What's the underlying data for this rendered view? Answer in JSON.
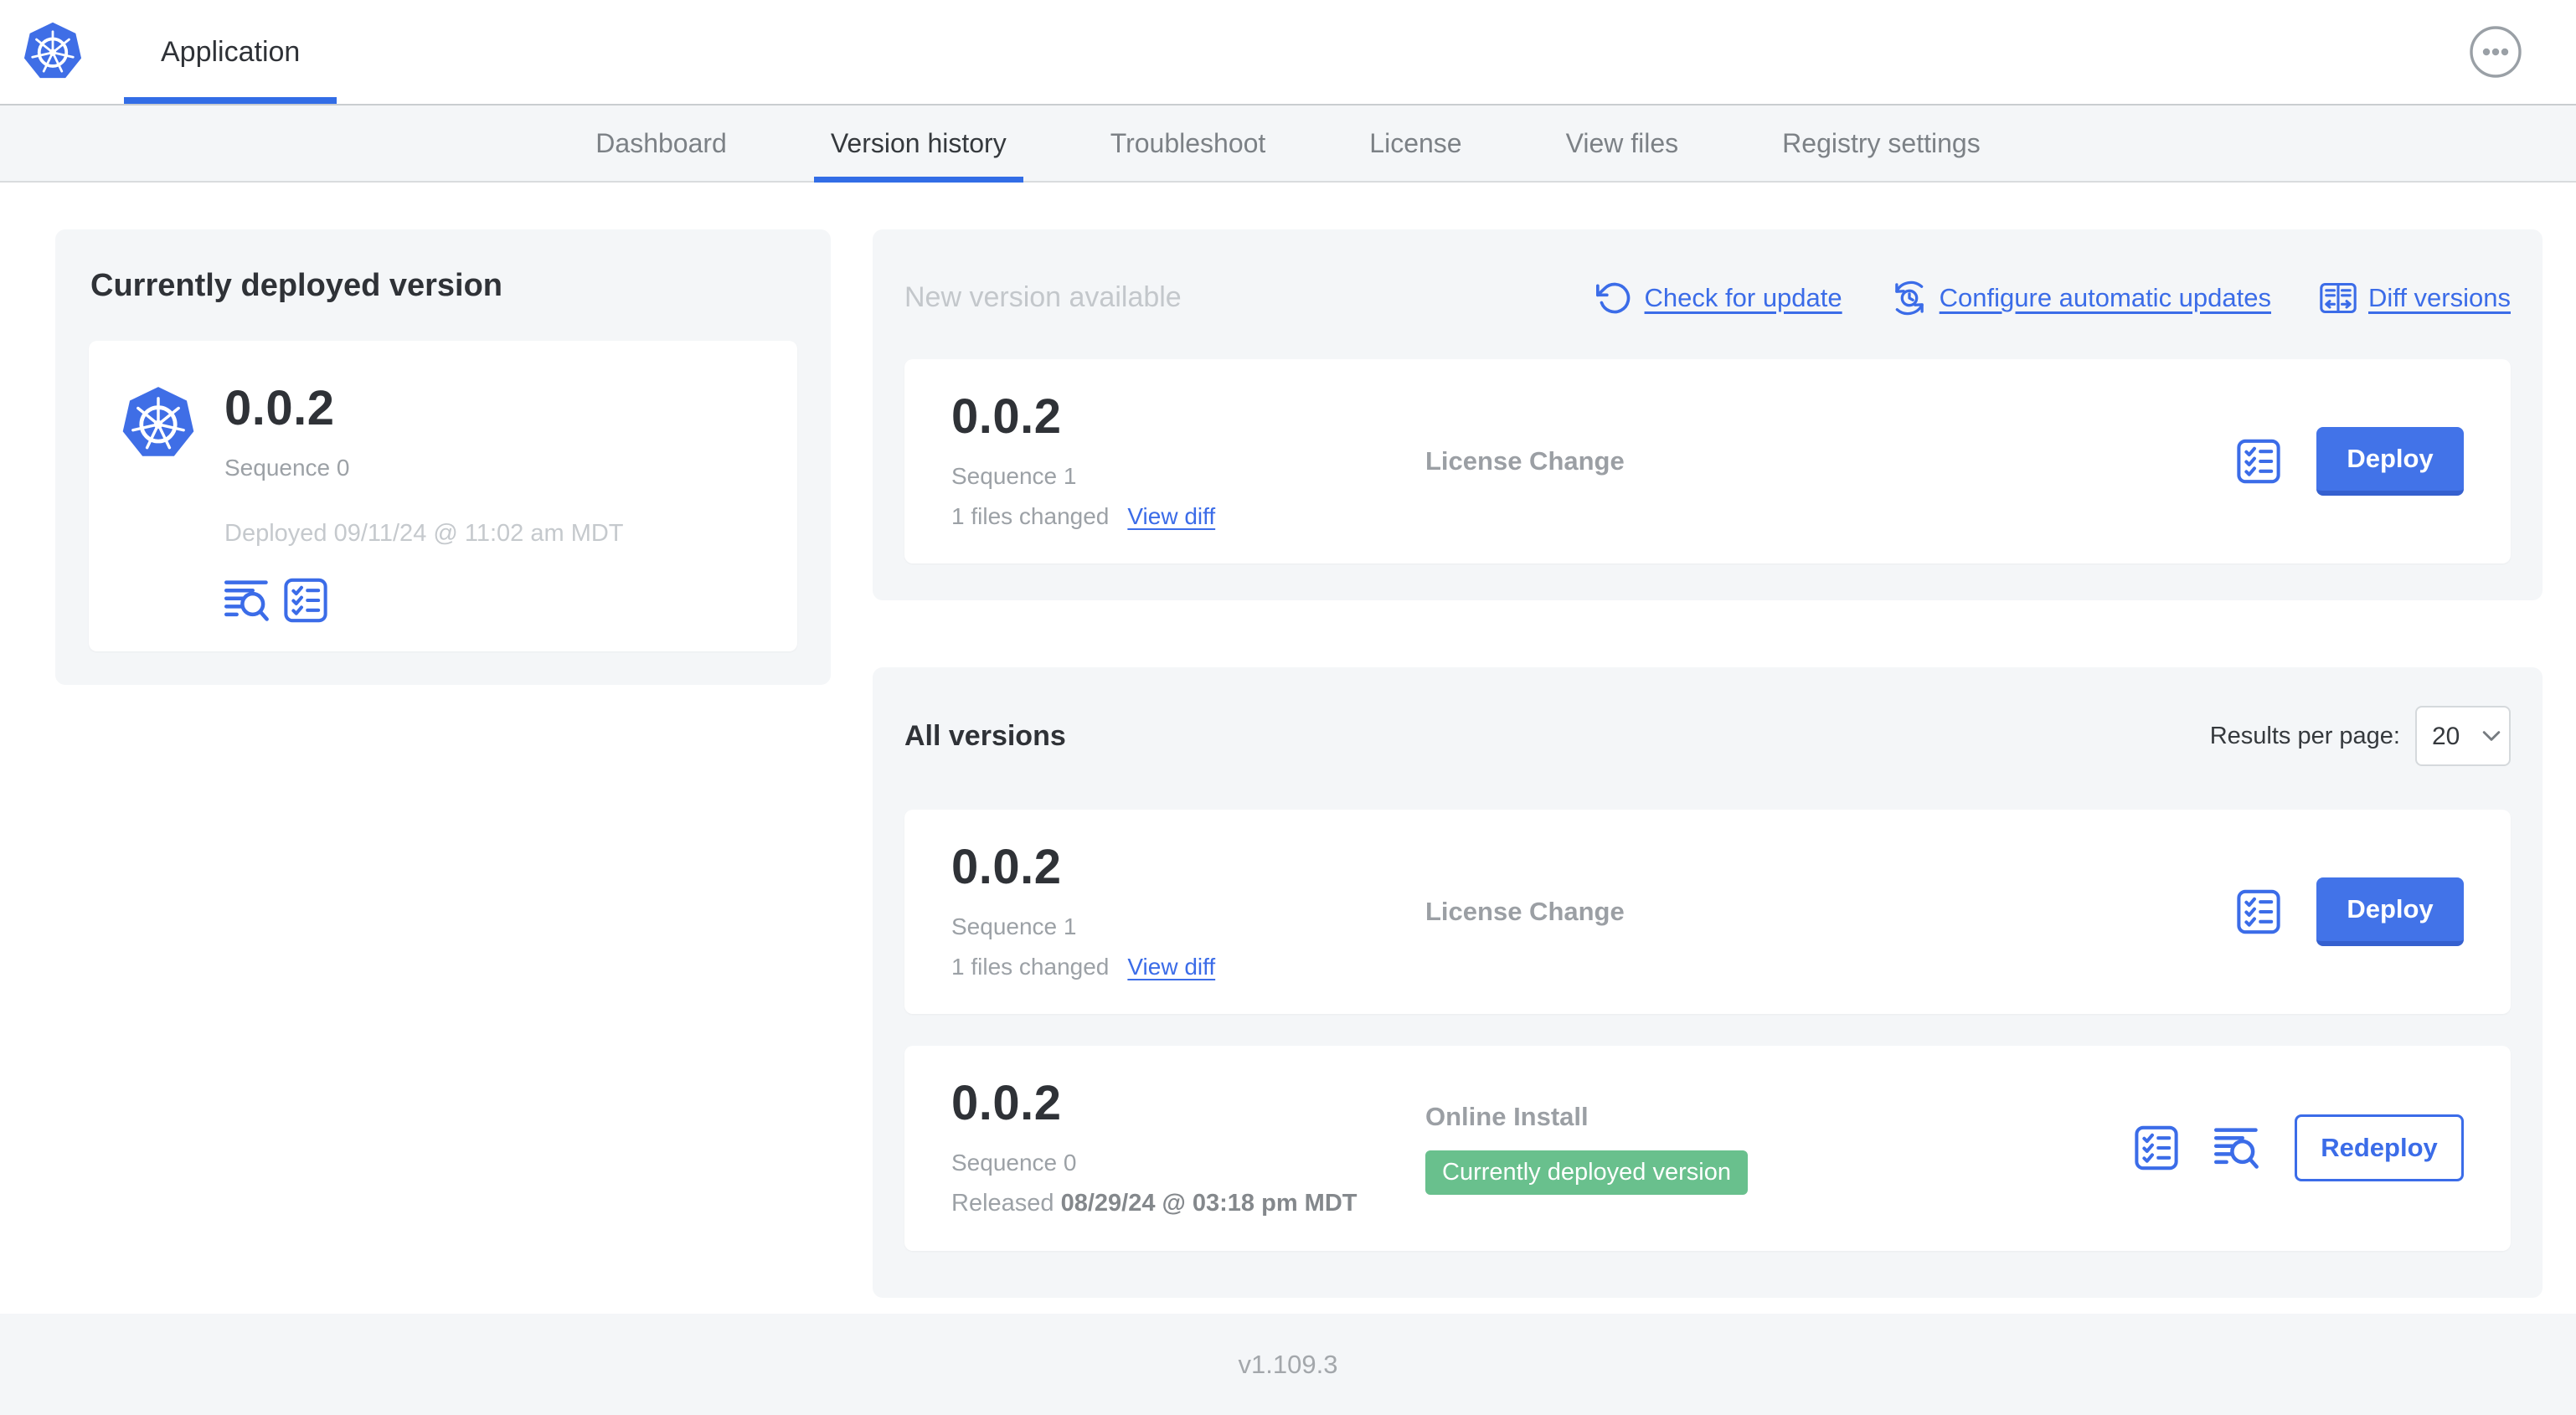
{
  "header": {
    "app_label": "Application"
  },
  "nav": {
    "tabs": [
      {
        "label": "Dashboard",
        "active": false
      },
      {
        "label": "Version history",
        "active": true
      },
      {
        "label": "Troubleshoot",
        "active": false
      },
      {
        "label": "License",
        "active": false
      },
      {
        "label": "View files",
        "active": false
      },
      {
        "label": "Registry settings",
        "active": false
      }
    ]
  },
  "current": {
    "title": "Currently deployed version",
    "version": "0.0.2",
    "sequence": "Sequence 0",
    "deployed": "Deployed 09/11/24 @ 11:02 am MDT"
  },
  "new_version": {
    "title": "New version available",
    "check_link": "Check for update",
    "configure_link": "Configure automatic updates",
    "diff_link": "Diff versions",
    "card": {
      "version": "0.0.2",
      "sequence": "Sequence 1",
      "files_changed": "1 files changed",
      "view_diff": "View diff",
      "source": "License Change",
      "deploy": "Deploy"
    }
  },
  "all_versions": {
    "title": "All versions",
    "results_per_page_label": "Results per page:",
    "results_per_page_value": "20",
    "rows": [
      {
        "version": "0.0.2",
        "sequence": "Sequence 1",
        "files_changed": "1 files changed",
        "view_diff": "View diff",
        "source": "License Change",
        "action": "Deploy"
      },
      {
        "version": "0.0.2",
        "sequence": "Sequence 0",
        "released_prefix": "Released ",
        "released_date": "08/29/24 @ 03:18 pm MDT",
        "source": "Online Install",
        "badge": "Currently deployed version",
        "action": "Redeploy"
      }
    ]
  },
  "footer": {
    "console_version": "v1.109.3"
  },
  "icons": {
    "kubernetes-logo": "blue heptagon with white ship's wheel",
    "more-options": "ellipsis in circle",
    "check-for-update": "counterclockwise refresh arrow",
    "configure-automatic-updates": "clock with circular arrows",
    "diff-versions": "split panes with left/right arrows",
    "preflight-checks": "checklist in rounded square",
    "deploy-logs": "text lines with magnifying glass",
    "results-dropdown": "chevron-down"
  },
  "colors": {
    "primary_blue": "#3b6ce8",
    "button_blue": "#4273e8",
    "active_tab_underline": "#326de6",
    "badge_green": "#69c08d",
    "panel_background": "#f4f6f8",
    "k8s_logo_blue": "#3f6ee6"
  }
}
